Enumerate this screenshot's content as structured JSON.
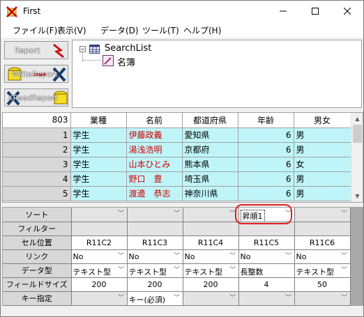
{
  "window": {
    "title": "First"
  },
  "menu": [
    "ファイル(F)",
    "表示(V)",
    "データ(D)",
    "ツール(T)",
    "ヘルプ(H)"
  ],
  "toolbar": [
    {
      "label": "Report",
      "icon": "report-icon"
    },
    {
      "label": "WriteReport",
      "icon": "write-report-icon"
    },
    {
      "label": "XReadReport",
      "icon": "read-report-icon"
    }
  ],
  "tree": {
    "root": "SearchList",
    "child": "名簿"
  },
  "grid": {
    "corner": "803",
    "columns": [
      "業種",
      "名前",
      "都道府県",
      "年齢",
      "男女"
    ],
    "rows": [
      {
        "num": "1",
        "cells": [
          "学生",
          "伊藤政義",
          "愛知県",
          "6",
          "男"
        ]
      },
      {
        "num": "2",
        "cells": [
          "学生",
          "湯浅浩明",
          "京都府",
          "6",
          "男"
        ]
      },
      {
        "num": "3",
        "cells": [
          "学生",
          "山本ひとみ",
          "熊本県",
          "6",
          "女"
        ]
      },
      {
        "num": "4",
        "cells": [
          "学生",
          "野口　豊",
          "埼玉県",
          "6",
          "男"
        ]
      },
      {
        "num": "5",
        "cells": [
          "学生",
          "渡邊　恭志",
          "神奈川県",
          "6",
          "男"
        ]
      }
    ]
  },
  "props": {
    "labels": [
      "ソート",
      "フィルター",
      "セル位置",
      "リンク",
      "データ型",
      "フィールドサイズ",
      "キー指定"
    ],
    "sort": [
      "",
      "",
      "",
      "昇順1",
      ""
    ],
    "cell_pos": [
      "R11C2",
      "R11C3",
      "R11C4",
      "R11C5",
      "R11C6"
    ],
    "link": [
      "No",
      "No",
      "No",
      "No",
      "No"
    ],
    "datatype": [
      "テキスト型",
      "テキスト型",
      "テキスト型",
      "長整数",
      "テキスト型"
    ],
    "fieldsize": [
      "200",
      "200",
      "200",
      "4",
      "50"
    ],
    "key": [
      "",
      "キー(必須)",
      "",
      "",
      ""
    ]
  },
  "colors": {
    "highlight": "#bff5f9",
    "red_text": "#d00000",
    "circle": "#e02020"
  }
}
